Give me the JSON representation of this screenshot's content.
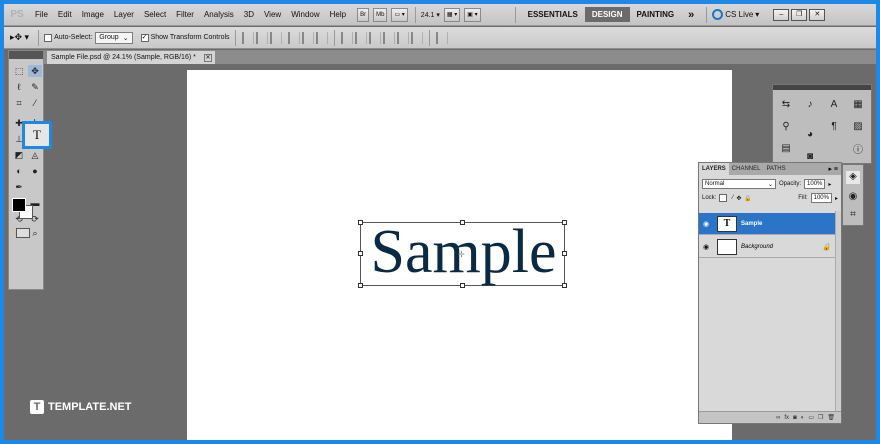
{
  "app": {
    "logo": "PS"
  },
  "menu": [
    "File",
    "Edit",
    "Image",
    "Layer",
    "Select",
    "Filter",
    "Analysis",
    "3D",
    "View",
    "Window",
    "Help"
  ],
  "menubar": {
    "br_label": "Br",
    "mb_label": "Mb",
    "zoom": "24.1",
    "workspaces": [
      "ESSENTIALS",
      "DESIGN",
      "PAINTING"
    ],
    "active_workspace": "DESIGN",
    "more": "»",
    "cs_live": "CS Live"
  },
  "options": {
    "auto_select_label": "Auto-Select:",
    "auto_select_value": "Group",
    "show_transform_label": "Show Transform Controls"
  },
  "document": {
    "tab_title": "Sample File.psd @ 24.1% (Sample, RGB/16) *",
    "text": "Sample"
  },
  "layers": {
    "tabs": [
      "LAYERS",
      "CHANNEL",
      "PATHS"
    ],
    "blend_mode": "Normal",
    "opacity_label": "Opacity:",
    "opacity_value": "100%",
    "lock_label": "Lock:",
    "fill_label": "Fill:",
    "fill_value": "100%",
    "items": [
      {
        "name": "Sample",
        "selected": true
      },
      {
        "name": "Background",
        "selected": false
      }
    ]
  },
  "watermark": {
    "text": "TEMPLATE.NET",
    "logo": "T"
  },
  "colors": {
    "accent": "#1e88e5",
    "selection": "#2a74c9",
    "text": "#0a2a44"
  }
}
